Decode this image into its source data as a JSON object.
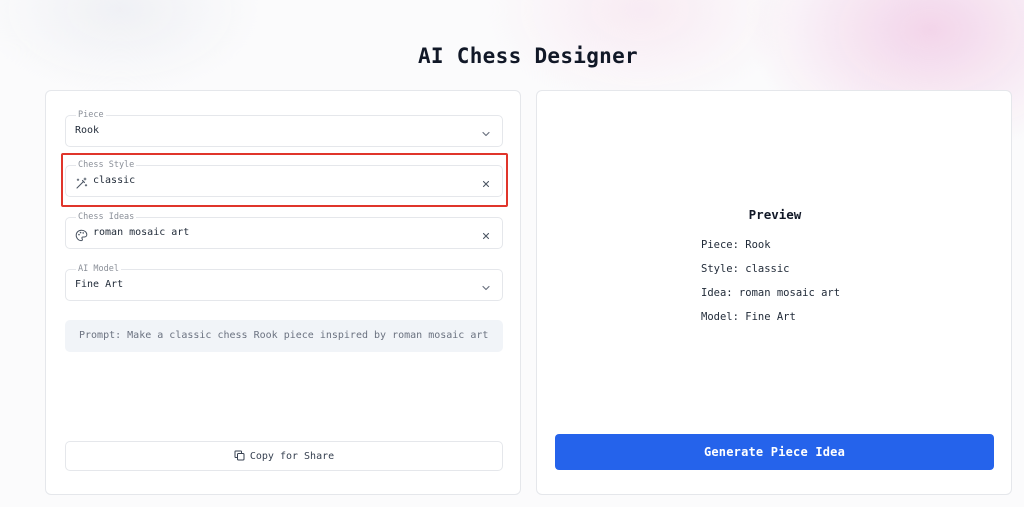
{
  "app": {
    "title": "AI Chess Designer"
  },
  "form": {
    "piece": {
      "label": "Piece",
      "value": "Rook"
    },
    "chess_style": {
      "label": "Chess Style",
      "value": "classic"
    },
    "chess_ideas": {
      "label": "Chess Ideas",
      "value": "roman mosaic art"
    },
    "ai_model": {
      "label": "AI Model",
      "value": "Fine Art"
    },
    "prompt": "Prompt: Make a classic chess Rook piece inspired by roman mosaic art",
    "copy_label": "Copy for Share"
  },
  "preview": {
    "title": "Preview",
    "piece_line": "Piece: Rook",
    "style_line": "Style: classic",
    "idea_line": "Idea: roman mosaic art",
    "model_line": "Model: Fine Art",
    "generate_label": "Generate Piece Idea"
  },
  "colors": {
    "accent": "#2563eb",
    "highlight": "#e0352b"
  },
  "icons": {
    "style_field": "magic-wand-icon",
    "ideas_field": "palette-icon",
    "dropdown": "chevron-down-icon",
    "clear": "close-icon",
    "copy": "copy-icon"
  }
}
